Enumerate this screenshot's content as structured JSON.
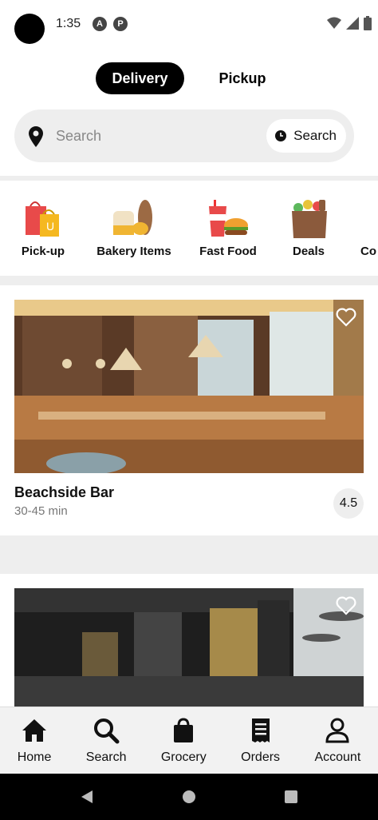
{
  "status_bar": {
    "time": "1:35",
    "icons": [
      "camera-dot",
      "a-badge-icon",
      "p-badge-icon",
      "wifi-icon",
      "signal-icon",
      "battery-icon"
    ]
  },
  "tabs": [
    {
      "label": "Delivery",
      "active": true
    },
    {
      "label": "Pickup",
      "active": false
    }
  ],
  "search": {
    "placeholder": "Search",
    "button_label": "Search"
  },
  "categories": [
    {
      "label": "Pick-up",
      "icon": "shopping-bags-icon"
    },
    {
      "label": "Bakery Items",
      "icon": "bread-icon"
    },
    {
      "label": "Fast Food",
      "icon": "burger-drink-icon"
    },
    {
      "label": "Deals",
      "icon": "grocery-bag-icon"
    },
    {
      "label": "Co",
      "icon": "partial-category-icon"
    }
  ],
  "restaurants": [
    {
      "name": "Beachside Bar",
      "time": "30-45 min",
      "rating": "4.5",
      "favorite": false
    },
    {
      "name": "",
      "time": "",
      "rating": "",
      "favorite": false
    }
  ],
  "bottom_nav": [
    {
      "label": "Home",
      "icon": "home-icon"
    },
    {
      "label": "Search",
      "icon": "search-icon"
    },
    {
      "label": "Grocery",
      "icon": "shopping-bag-icon"
    },
    {
      "label": "Orders",
      "icon": "receipt-icon"
    },
    {
      "label": "Account",
      "icon": "account-icon"
    }
  ],
  "colors": {
    "accent": "#000000",
    "surface": "#eeeeee",
    "nav_bg": "#f2f2f2"
  }
}
